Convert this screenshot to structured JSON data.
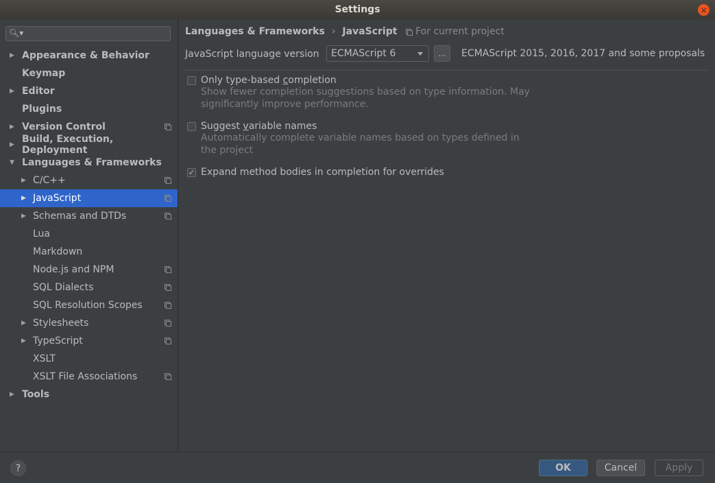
{
  "window": {
    "title": "Settings",
    "close_icon": "×"
  },
  "search": {
    "icon": "🔍︎▾",
    "placeholder": ""
  },
  "sidebar": {
    "items": [
      {
        "label": "Appearance & Behavior",
        "level": 0,
        "arrow": "▶",
        "bold": true,
        "project_scoped": false
      },
      {
        "label": "Keymap",
        "level": 0,
        "arrow": "",
        "bold": true,
        "project_scoped": false
      },
      {
        "label": "Editor",
        "level": 0,
        "arrow": "▶",
        "bold": true,
        "project_scoped": false
      },
      {
        "label": "Plugins",
        "level": 0,
        "arrow": "",
        "bold": true,
        "project_scoped": false
      },
      {
        "label": "Version Control",
        "level": 0,
        "arrow": "▶",
        "bold": true,
        "project_scoped": true
      },
      {
        "label": "Build, Execution, Deployment",
        "level": 0,
        "arrow": "▶",
        "bold": true,
        "project_scoped": false
      },
      {
        "label": "Languages & Frameworks",
        "level": 0,
        "arrow": "▼",
        "bold": true,
        "project_scoped": false
      },
      {
        "label": "C/C++",
        "level": 1,
        "arrow": "▶",
        "bold": false,
        "project_scoped": true
      },
      {
        "label": "JavaScript",
        "level": 1,
        "arrow": "▶",
        "bold": false,
        "project_scoped": true,
        "selected": true
      },
      {
        "label": "Schemas and DTDs",
        "level": 1,
        "arrow": "▶",
        "bold": false,
        "project_scoped": true
      },
      {
        "label": "Lua",
        "level": 1,
        "arrow": "",
        "bold": false,
        "project_scoped": false
      },
      {
        "label": "Markdown",
        "level": 1,
        "arrow": "",
        "bold": false,
        "project_scoped": false
      },
      {
        "label": "Node.js and NPM",
        "level": 1,
        "arrow": "",
        "bold": false,
        "project_scoped": true
      },
      {
        "label": "SQL Dialects",
        "level": 1,
        "arrow": "",
        "bold": false,
        "project_scoped": true
      },
      {
        "label": "SQL Resolution Scopes",
        "level": 1,
        "arrow": "",
        "bold": false,
        "project_scoped": true
      },
      {
        "label": "Stylesheets",
        "level": 1,
        "arrow": "▶",
        "bold": false,
        "project_scoped": true
      },
      {
        "label": "TypeScript",
        "level": 1,
        "arrow": "▶",
        "bold": false,
        "project_scoped": true
      },
      {
        "label": "XSLT",
        "level": 1,
        "arrow": "",
        "bold": false,
        "project_scoped": false
      },
      {
        "label": "XSLT File Associations",
        "level": 1,
        "arrow": "",
        "bold": false,
        "project_scoped": true
      },
      {
        "label": "Tools",
        "level": 0,
        "arrow": "▶",
        "bold": true,
        "project_scoped": false
      }
    ]
  },
  "main": {
    "breadcrumb": {
      "parent": "Languages & Frameworks",
      "separator": "›",
      "current": "JavaScript"
    },
    "scope_label": "For current project",
    "language_version": {
      "label": "JavaScript language version",
      "selected": "ECMAScript 6",
      "ellipsis_label": "...",
      "description": "ECMAScript 2015, 2016, 2017 and some proposals"
    },
    "options": [
      {
        "label_pre": "Only type-based ",
        "label_mnemonic": "c",
        "label_post": "ompletion",
        "checked": false,
        "description": "Show fewer completion suggestions based on type information. May significantly improve performance."
      },
      {
        "label_pre": "Suggest ",
        "label_mnemonic": "v",
        "label_post": "ariable names",
        "checked": false,
        "description": "Automatically complete variable names based on types defined in the project"
      },
      {
        "label_pre": "Expand method bodies in completion for overrides",
        "label_mnemonic": "",
        "label_post": "",
        "checked": true,
        "description": ""
      }
    ]
  },
  "footer": {
    "help_label": "?",
    "ok_label": "OK",
    "cancel_label": "Cancel",
    "apply_label": "Apply"
  },
  "colors": {
    "selection": "#2f65ca",
    "ok_button": "#365880",
    "close_button": "#e95420",
    "background": "#3c3f41"
  }
}
